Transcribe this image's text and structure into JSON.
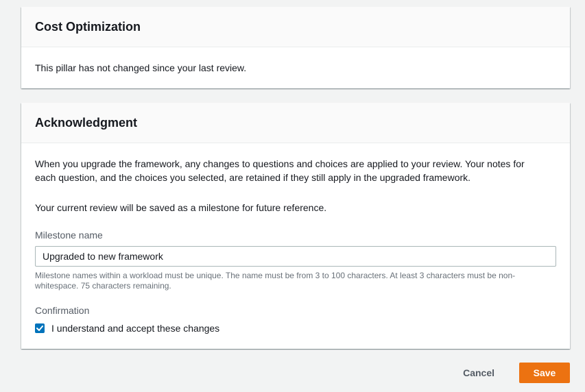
{
  "cost_panel": {
    "title": "Cost Optimization",
    "body": "This pillar has not changed since your last review."
  },
  "ack_panel": {
    "title": "Acknowledgment",
    "paragraph1_line1": "When you upgrade the framework, any changes to questions and choices are applied to your review. Your notes for",
    "paragraph1_line2": "each question, and the choices you selected, are retained if they still apply in the upgraded framework.",
    "paragraph2": "Your current review will be saved as a milestone for future reference.",
    "milestone_label": "Milestone name",
    "milestone_value": "Upgraded to new framework",
    "milestone_hint": "Milestone names within a workload must be unique. The name must be from 3 to 100 characters. At least 3 characters must be non-whitespace. 75 characters remaining.",
    "confirmation_label": "Confirmation",
    "checkbox_label": "I understand and accept these changes",
    "checkbox_checked": true
  },
  "actions": {
    "cancel_label": "Cancel",
    "save_label": "Save"
  },
  "colors": {
    "accent": "#ec7211",
    "checkbox": "#0073bb"
  },
  "icons": {
    "checkbox": "check-icon"
  }
}
